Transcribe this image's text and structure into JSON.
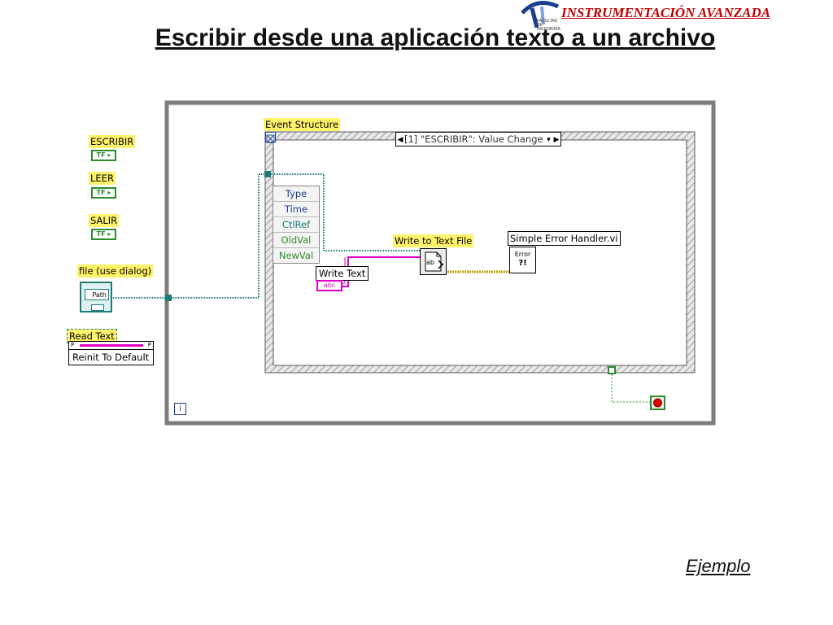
{
  "header": {
    "brand": "INSTRUMENTACIÓN AVANZADA",
    "logo_text": "FACULTAD DE INGENIERÍA"
  },
  "slide_title": "Escribir desde una aplicación texto a un archivo",
  "footer_link": "Ejemplo",
  "controls": {
    "escribir": "ESCRIBIR",
    "leer": "LEER",
    "salir": "SALIR",
    "bool_glyph": "TF",
    "file_label": "file (use dialog)",
    "path_glyph": "Path",
    "read_text": "Read Text",
    "read_text_ref_a": "P",
    "read_text_ref_b": "P",
    "reinit": "Reinit To Default"
  },
  "event_structure": {
    "label": "Event Structure",
    "case_selector": "[1] \"ESCRIBIR\": Value Change",
    "event_data": [
      "Type",
      "Time",
      "CtlRef",
      "OldVal",
      "NewVal"
    ]
  },
  "nodes": {
    "write_text": "Write Text",
    "write_text_glyph": "abc",
    "write_to_file": "Write to Text File",
    "write_to_file_glyph": "ab",
    "error_handler": "Simple Error Handler.vi",
    "error_glyph_top": "Error",
    "error_glyph_bottom": "?!"
  },
  "loop": {
    "iteration": "i"
  },
  "colors": {
    "brand": "#c00000",
    "label_bg": "#fff36a",
    "bool": "#2d8c2d",
    "path_wire": "#1f7a7a",
    "string_wire": "#e000c8",
    "error_wire": "#b8a400",
    "loop_frame": "#808080",
    "stop": "#e00000"
  }
}
